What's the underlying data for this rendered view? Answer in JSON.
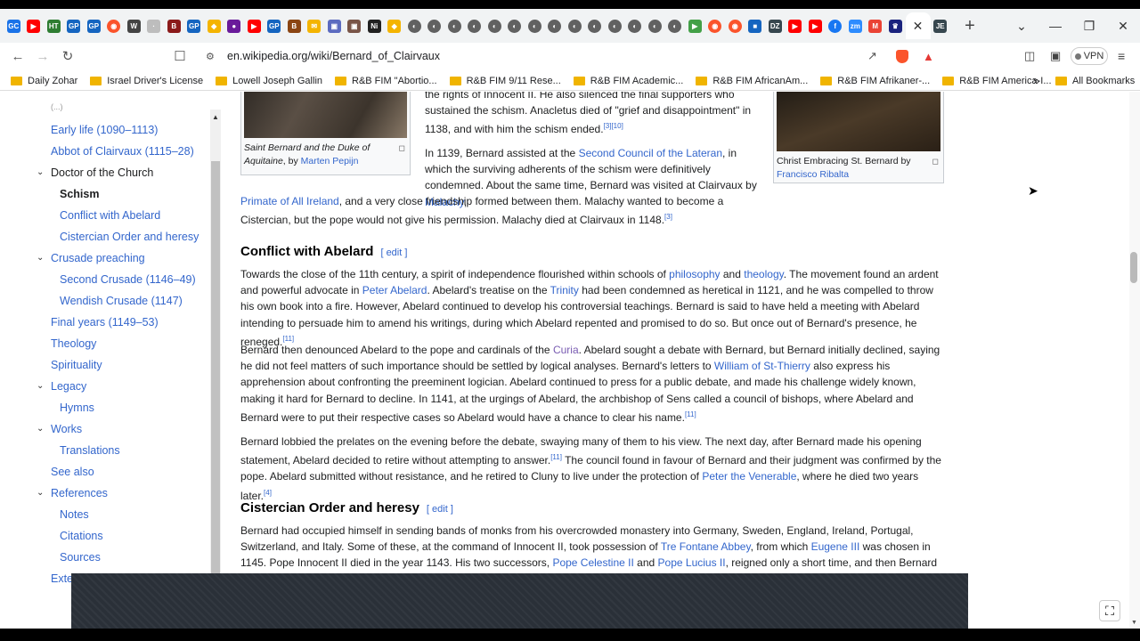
{
  "browser": {
    "tabs": [
      {
        "icon": "gc-icon",
        "label": "GC",
        "color": "#1a73e8"
      },
      {
        "icon": "youtube-icon",
        "label": "▶",
        "color": "#ff0000"
      },
      {
        "icon": "nyt-icon",
        "label": "HT",
        "color": "#2e7d32"
      },
      {
        "icon": "gp-icon",
        "label": "GP",
        "color": "#1565c0"
      },
      {
        "icon": "gp-icon",
        "label": "GP",
        "color": "#1565c0"
      },
      {
        "icon": "brave-icon",
        "label": "◉",
        "color": "#fb542b"
      },
      {
        "icon": "wikipedia-icon",
        "label": "W",
        "color": "#444444"
      },
      {
        "icon": "generic-icon",
        "label": "·",
        "color": "#bdbdbd"
      },
      {
        "icon": "book-icon",
        "label": "B",
        "color": "#8b1a1a"
      },
      {
        "icon": "gp-icon",
        "label": "GP",
        "color": "#1565c0"
      },
      {
        "icon": "shield-icon",
        "label": "◆",
        "color": "#f4b400"
      },
      {
        "icon": "person-icon",
        "label": "●",
        "color": "#6a1b9a"
      },
      {
        "icon": "youtube-icon",
        "label": "▶",
        "color": "#ff0000"
      },
      {
        "icon": "gp-icon",
        "label": "GP",
        "color": "#1565c0"
      },
      {
        "icon": "book-icon",
        "label": "B",
        "color": "#8b4513"
      },
      {
        "icon": "mail-icon",
        "label": "✉",
        "color": "#f4b400"
      },
      {
        "icon": "image-icon",
        "label": "▣",
        "color": "#5c6bc0"
      },
      {
        "icon": "image-icon",
        "label": "▣",
        "color": "#795548"
      },
      {
        "icon": "ni-icon",
        "label": "Ni",
        "color": "#212121"
      },
      {
        "icon": "shield-icon",
        "label": "◆",
        "color": "#f4b400"
      },
      {
        "icon": "circle-icon",
        "label": "◐",
        "color": "#616161"
      },
      {
        "icon": "circle-icon",
        "label": "◐",
        "color": "#616161"
      },
      {
        "icon": "circle-icon",
        "label": "◐",
        "color": "#616161"
      },
      {
        "icon": "circle-icon",
        "label": "◐",
        "color": "#616161"
      },
      {
        "icon": "circle-icon",
        "label": "◐",
        "color": "#616161"
      },
      {
        "icon": "circle-icon",
        "label": "◐",
        "color": "#616161"
      },
      {
        "icon": "circle-icon",
        "label": "◐",
        "color": "#616161"
      },
      {
        "icon": "circle-icon",
        "label": "◐",
        "color": "#616161"
      },
      {
        "icon": "circle-icon",
        "label": "◐",
        "color": "#616161"
      },
      {
        "icon": "circle-icon",
        "label": "◐",
        "color": "#616161"
      },
      {
        "icon": "circle-icon",
        "label": "◐",
        "color": "#616161"
      },
      {
        "icon": "circle-icon",
        "label": "◐",
        "color": "#616161"
      },
      {
        "icon": "circle-icon",
        "label": "◐",
        "color": "#616161"
      },
      {
        "icon": "circle-icon",
        "label": "◐",
        "color": "#616161"
      },
      {
        "icon": "play-icon",
        "label": "▶",
        "color": "#43a047"
      },
      {
        "icon": "brave-icon",
        "label": "◉",
        "color": "#fb542b"
      },
      {
        "icon": "brave-icon",
        "label": "◉",
        "color": "#fb542b"
      },
      {
        "icon": "news-icon",
        "label": "■",
        "color": "#1565c0"
      },
      {
        "icon": "dz-icon",
        "label": "DZ",
        "color": "#37474f"
      },
      {
        "icon": "youtube-icon",
        "label": "▶",
        "color": "#ff0000"
      },
      {
        "icon": "youtube-icon",
        "label": "▶",
        "color": "#ff0000"
      },
      {
        "icon": "facebook-icon",
        "label": "f",
        "color": "#1877f2"
      },
      {
        "icon": "zoom-icon",
        "label": "zm",
        "color": "#2d8cff"
      },
      {
        "icon": "gmail-icon",
        "label": "M",
        "color": "#ea4335"
      },
      {
        "icon": "crest-icon",
        "label": "♛",
        "color": "#1a237e"
      }
    ],
    "active_tab_close": "✕",
    "last_tab": {
      "icon": "je-icon",
      "label": "JE",
      "color": "#37474f"
    },
    "new_tab": "+",
    "tab_menu": "⌄",
    "minimize": "—",
    "restore": "❐",
    "close": "✕",
    "url": "en.wikipedia.org/wiki/Bernard_of_Clairvaux",
    "vpn_label": "VPN",
    "bookmarks": [
      "Daily Zohar",
      "Israel Driver's License",
      "Lowell Joseph Gallin",
      "R&B FIM \"Abortio...",
      "R&B FIM 9/11 Rese...",
      "R&B FIM Academic...",
      "R&B FIM AfricanAm...",
      "R&B FIM Afrikaner-...",
      "R&B FIM America-I..."
    ],
    "more_bookmarks": "»",
    "all_bookmarks": "All Bookmarks"
  },
  "toc": {
    "partial_top": "(...)",
    "early_life": "Early life (1090–1113)",
    "abbot": "Abbot of Clairvaux (1115–28)",
    "doctor": "Doctor of the Church",
    "schism": "Schism",
    "conflict": "Conflict with Abelard",
    "cistercian": "Cistercian Order and heresy",
    "crusade": "Crusade preaching",
    "second_crusade": "Second Crusade (1146–49)",
    "wendish": "Wendish Crusade (1147)",
    "final_years": "Final years (1149–53)",
    "theology": "Theology",
    "spirituality": "Spirituality",
    "legacy": "Legacy",
    "hymns": "Hymns",
    "works": "Works",
    "translations": "Translations",
    "see_also": "See also",
    "references": "References",
    "notes": "Notes",
    "citations": "Citations",
    "sources": "Sources",
    "external": "Exte"
  },
  "article": {
    "top_line_partial": "the rights of Innocent II. He also silenced the final supporters who",
    "p0": {
      "l1": "sustained the schism. Anacletus died of \"grief and disappointment\" in",
      "l2": "1138, and with him the schism ended.",
      "ref": "[3][10]"
    },
    "p1": {
      "t1": "In 1139, Bernard assisted at the ",
      "link1": "Second Council of the Lateran",
      "t2": ", in which the surviving adherents of the schism were definitively condemned. About the same time, Bernard was visited at Clairvaux by ",
      "link2": "Malachy",
      "t3": ", ",
      "link3": "Primate of All Ireland",
      "t4": ", and a very close friendship formed between them. Malachy wanted to become a Cistercian, but the pope would not give his permission. Malachy died at Clairvaux in 1148.",
      "ref": "[3]"
    },
    "caption_left": {
      "t1": "Saint Bernard and the Duke of Aquitaine",
      "t2": ", by ",
      "link": "Marten Pepijn"
    },
    "caption_right": {
      "t1": "Christ Embracing St. Bernard by ",
      "link": "Francisco Ribalta"
    },
    "h_conflict": "Conflict with Abelard",
    "edit_label": "[ edit ]",
    "c1": {
      "t1": "Towards the close of the 11th century, a spirit of independence flourished within schools of ",
      "link1": "philosophy",
      "t2": " and ",
      "link2": "theology",
      "t3": ". The movement found an ardent and powerful advocate in ",
      "link3": "Peter Abelard",
      "t4": ". Abelard's treatise on the ",
      "link4": "Trinity",
      "t5": " had been condemned as heretical in 1121, and he was compelled to throw his own book into a fire. However, Abelard continued to develop his controversial teachings. Bernard is said to have held a meeting with Abelard intending to persuade him to amend his writings, during which Abelard repented and promised to do so. But once out of Bernard's presence, he reneged.",
      "ref": "[11]"
    },
    "c2": {
      "t1": "Bernard then denounced Abelard to the pope and cardinals of the ",
      "link1": "Curia",
      "t2": ". Abelard sought a debate with Bernard, but Bernard initially declined, saying he did not feel matters of such importance should be settled by logical analyses. Bernard's letters to ",
      "link2": "William of St-Thierry",
      "t3": " also express his apprehension about confronting the preeminent logician. Abelard continued to press for a public debate, and made his challenge widely known, making it hard for Bernard to decline. In 1141, at the urgings of Abelard, the archbishop of Sens called a council of bishops, where Abelard and Bernard were to put their respective cases so Abelard would have a chance to clear his name.",
      "ref": "[11]"
    },
    "c3": {
      "t1": "Bernard lobbied the prelates on the evening before the debate, swaying many of them to his view. The next day, after Bernard made his opening statement, Abelard decided to retire without attempting to answer.",
      "ref1": "[11]",
      "t2": " The council found in favour of Bernard and their judgment was confirmed by the pope. Abelard submitted without resistance, and he retired to Cluny to live under the protection of ",
      "link1": "Peter the Venerable",
      "t3": ", where he died two years later.",
      "ref2": "[4]"
    },
    "h_cistercian": "Cistercian Order and heresy",
    "d1": {
      "t1": "Bernard had occupied himself in sending bands of monks from his overcrowded monastery into Germany, Sweden, England, Ireland, Portugal, Switzerland, and Italy. Some of these, at the command of Innocent II, took possession of ",
      "link1": "Tre Fontane Abbey",
      "t2": ", from which ",
      "link2": "Eugene III",
      "t3": " was chosen in 1145. Pope Innocent II died in the year 1143. His two successors, ",
      "link3": "Pope Celestine II",
      "t4": " and ",
      "link4": "Pope Lucius II",
      "t5": ", reigned only a short time, and then Bernard saw one of"
    }
  }
}
